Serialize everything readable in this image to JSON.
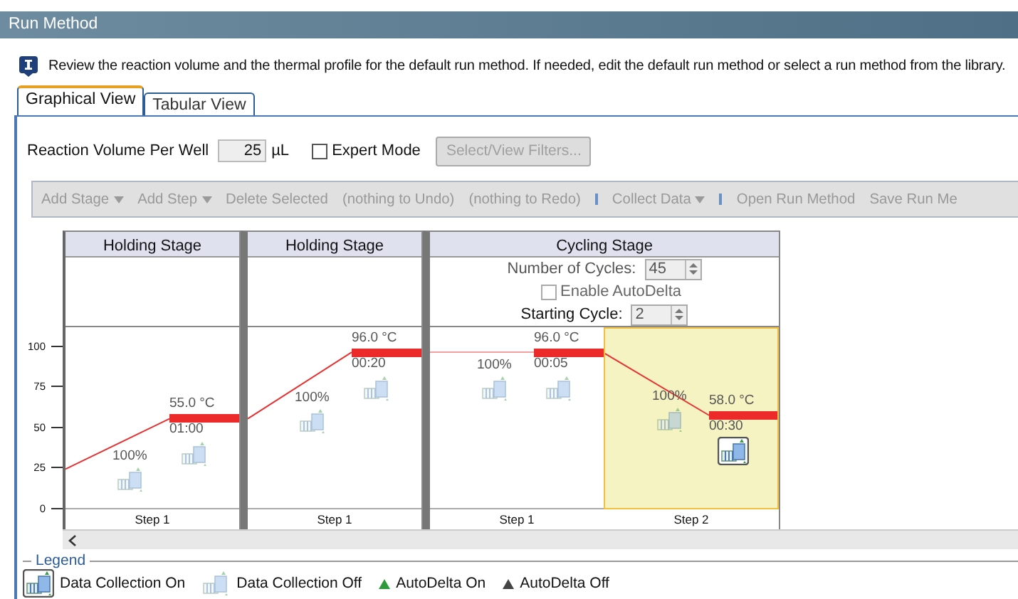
{
  "window": {
    "title": "Run Method"
  },
  "info": {
    "text": "Review the reaction volume and the thermal profile for the default run method. If needed, edit the default run method or select a run method from the library."
  },
  "tabs": [
    {
      "label": "Graphical View",
      "selected": true
    },
    {
      "label": "Tabular View",
      "selected": false
    }
  ],
  "reaction_volume": {
    "label": "Reaction Volume Per Well",
    "value": "25",
    "unit": "µL"
  },
  "expert_mode": {
    "label": "Expert Mode",
    "checked": false
  },
  "filters_button": {
    "label": "Select/View Filters...",
    "disabled": true
  },
  "toolbar": [
    {
      "kind": "button",
      "label": "Add Stage",
      "dropdown": true,
      "disabled": true
    },
    {
      "kind": "button",
      "label": "Add Step",
      "dropdown": true,
      "disabled": true
    },
    {
      "kind": "button",
      "label": "Delete Selected",
      "dropdown": false,
      "disabled": true
    },
    {
      "kind": "button",
      "label": "(nothing to Undo)",
      "dropdown": false,
      "disabled": true
    },
    {
      "kind": "button",
      "label": "(nothing to Redo)",
      "dropdown": false,
      "disabled": true
    },
    {
      "kind": "separator"
    },
    {
      "kind": "button",
      "label": "Collect Data",
      "dropdown": true,
      "disabled": true
    },
    {
      "kind": "separator"
    },
    {
      "kind": "button",
      "label": "Open Run Method",
      "dropdown": false,
      "disabled": true
    },
    {
      "kind": "button",
      "label": "Save Run Me",
      "dropdown": false,
      "disabled": true
    }
  ],
  "y_axis": {
    "ticks": [
      "100",
      "75",
      "50",
      "25",
      "0"
    ]
  },
  "stages": [
    {
      "kind": "holding",
      "title": "Holding Stage",
      "steps": [
        {
          "label": "Step 1",
          "temperature": "55.0 °C",
          "time": "01:00",
          "ramp": "100%",
          "ramp_collect": false,
          "hold_collect": false,
          "selected": false
        }
      ]
    },
    {
      "kind": "holding",
      "title": "Holding Stage",
      "steps": [
        {
          "label": "Step 1",
          "temperature": "96.0 °C",
          "time": "00:20",
          "ramp": "100%",
          "ramp_collect": false,
          "hold_collect": false,
          "selected": false
        }
      ]
    },
    {
      "kind": "cycling",
      "title": "Cycling Stage",
      "cycles": {
        "label": "Number of Cycles:",
        "value": "45"
      },
      "auto_delta": {
        "label": "Enable AutoDelta",
        "checked": false
      },
      "starting_cycle": {
        "label": "Starting Cycle:",
        "value": "2"
      },
      "steps": [
        {
          "label": "Step 1",
          "temperature": "96.0 °C",
          "time": "00:05",
          "ramp": "100%",
          "ramp_collect": false,
          "hold_collect": false,
          "selected": false
        },
        {
          "label": "Step 2",
          "temperature": "58.0 °C",
          "time": "00:30",
          "ramp": "100%",
          "ramp_collect": false,
          "hold_collect": true,
          "selected": true
        }
      ]
    }
  ],
  "legend": {
    "title": "Legend",
    "items": [
      {
        "kind": "collect_on",
        "label": "Data Collection On"
      },
      {
        "kind": "collect_off",
        "label": "Data Collection Off"
      },
      {
        "kind": "delta_on",
        "label": "AutoDelta On"
      },
      {
        "kind": "delta_off",
        "label": "AutoDelta Off"
      }
    ]
  }
}
